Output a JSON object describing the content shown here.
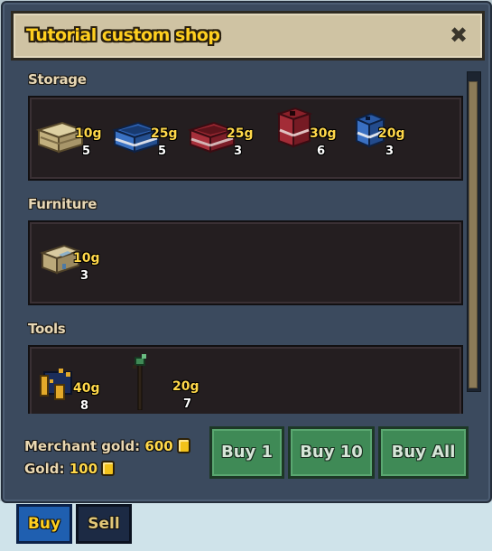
{
  "window": {
    "title": "Tutorial custom shop"
  },
  "sections": [
    {
      "title": "Storage",
      "items": [
        {
          "icon": "wooden-crate-icon",
          "price": "10g",
          "qty": "5"
        },
        {
          "icon": "blue-crate-icon",
          "price": "25g",
          "qty": "5"
        },
        {
          "icon": "red-crate-icon",
          "price": "25g",
          "qty": "3"
        },
        {
          "icon": "red-cabinet-icon",
          "price": "30g",
          "qty": "6"
        },
        {
          "icon": "blue-cabinet-icon",
          "price": "20g",
          "qty": "3"
        }
      ]
    },
    {
      "title": "Furniture",
      "items": [
        {
          "icon": "blueprint-table-icon",
          "price": "10g",
          "qty": "3"
        }
      ]
    },
    {
      "title": "Tools",
      "items": [
        {
          "icon": "tool-kit-icon",
          "price": "40g",
          "qty": "8"
        },
        {
          "icon": "staff-icon",
          "price": "20g",
          "qty": "7"
        }
      ]
    }
  ],
  "footer": {
    "merchant_gold_label": "Merchant gold:",
    "merchant_gold_value": "600",
    "gold_label": "Gold:",
    "gold_value": "100",
    "buy1": "Buy 1",
    "buy10": "Buy 10",
    "buyall": "Buy All"
  },
  "tabs": {
    "buy": "Buy",
    "sell": "Sell"
  },
  "colors": {
    "accent": "#ffcf1f",
    "button": "#3f8a56",
    "panel": "#241e20",
    "window": "#3b4a5e",
    "tab_active": "#1f5fb0",
    "tab_inactive": "#1c2a44"
  }
}
